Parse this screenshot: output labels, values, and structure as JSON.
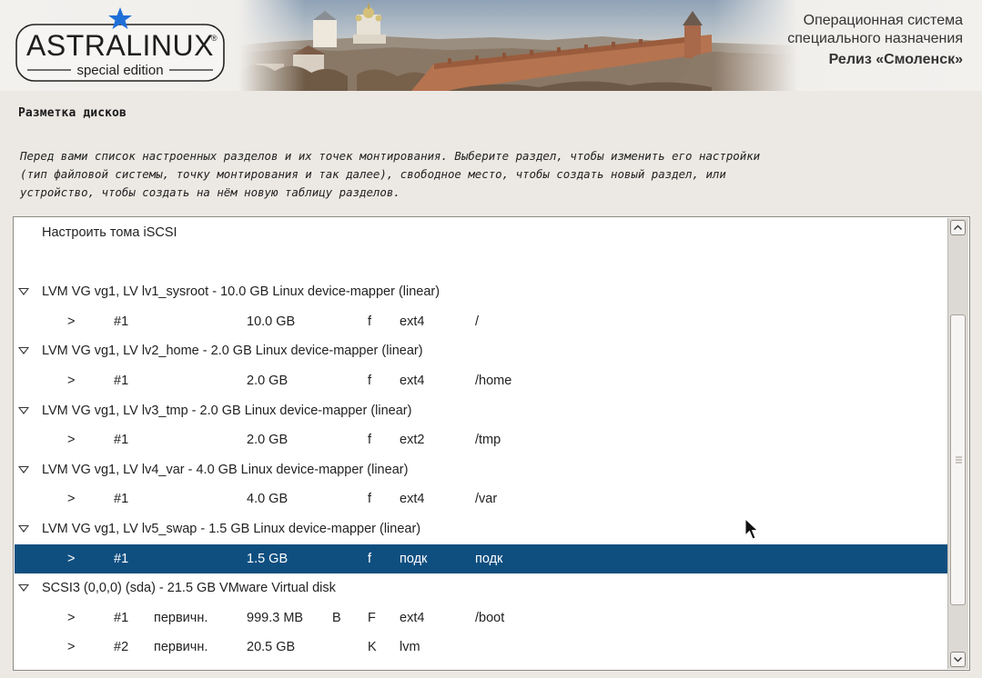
{
  "banner": {
    "logo_text": "ASTRALINUX",
    "logo_registered": "®",
    "logo_subtitle": "special edition",
    "release_line1": "Операционная система",
    "release_line2": "специального назначения",
    "release_line3": "Релиз «Смоленск»"
  },
  "heading": "Разметка дисков",
  "description_lines": [
    "Перед вами список настроенных разделов и их точек монтирования. Выберите раздел, чтобы изменить его настройки",
    "(тип файловой системы, точку монтирования и так далее), свободное место, чтобы создать новый раздел, или",
    "устройство, чтобы создать на нём новую таблицу разделов."
  ],
  "colors": {
    "selection": "#0f4f80",
    "logo_star": "#1f6fd8"
  },
  "rows": [
    {
      "kind": "item",
      "label": "Настроить тома iSCSI"
    },
    {
      "kind": "blank"
    },
    {
      "kind": "header",
      "label": "LVM VG vg1, LV lv1_sysroot - 10.0 GB Linux device-mapper (linear)"
    },
    {
      "kind": "partition",
      "arrow": ">",
      "num": "#1",
      "type": "",
      "size": "10.0 GB",
      "boot": "",
      "flag": "f",
      "fs": "ext4",
      "mount": "/",
      "selected": false
    },
    {
      "kind": "header",
      "label": "LVM VG vg1, LV lv2_home - 2.0 GB Linux device-mapper (linear)"
    },
    {
      "kind": "partition",
      "arrow": ">",
      "num": "#1",
      "type": "",
      "size": "2.0 GB",
      "boot": "",
      "flag": "f",
      "fs": "ext4",
      "mount": "/home",
      "selected": false
    },
    {
      "kind": "header",
      "label": "LVM VG vg1, LV lv3_tmp - 2.0 GB Linux device-mapper (linear)"
    },
    {
      "kind": "partition",
      "arrow": ">",
      "num": "#1",
      "type": "",
      "size": "2.0 GB",
      "boot": "",
      "flag": "f",
      "fs": "ext2",
      "mount": "/tmp",
      "selected": false
    },
    {
      "kind": "header",
      "label": "LVM VG vg1, LV lv4_var - 4.0 GB Linux device-mapper (linear)"
    },
    {
      "kind": "partition",
      "arrow": ">",
      "num": "#1",
      "type": "",
      "size": "4.0 GB",
      "boot": "",
      "flag": "f",
      "fs": "ext4",
      "mount": "/var",
      "selected": false
    },
    {
      "kind": "header",
      "label": "LVM VG vg1, LV lv5_swap - 1.5 GB Linux device-mapper (linear)"
    },
    {
      "kind": "partition",
      "arrow": ">",
      "num": "#1",
      "type": "",
      "size": "1.5 GB",
      "boot": "",
      "flag": "f",
      "fs": "подк",
      "mount": "подк",
      "selected": true
    },
    {
      "kind": "header",
      "label": "SCSI3 (0,0,0) (sda) - 21.5 GB VMware Virtual disk"
    },
    {
      "kind": "partition",
      "arrow": ">",
      "num": "#1",
      "type": "первичн.",
      "size": "999.3 MB",
      "boot": "B",
      "flag": "F",
      "fs": "ext4",
      "mount": "/boot",
      "selected": false
    },
    {
      "kind": "partition",
      "arrow": ">",
      "num": "#2",
      "type": "первичн.",
      "size": "20.5 GB",
      "boot": "",
      "flag": "K",
      "fs": "lvm",
      "mount": "",
      "selected": false
    }
  ]
}
